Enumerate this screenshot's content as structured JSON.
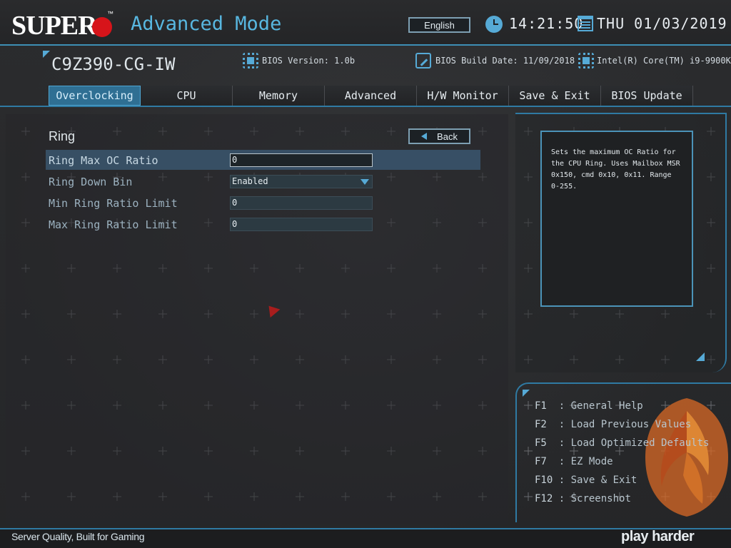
{
  "header": {
    "brand": "SUPER",
    "brand_tm": "™",
    "mode_title": "Advanced Mode",
    "language_button": "English",
    "time": "14:21:50",
    "date": "THU 01/03/2019"
  },
  "board_info": {
    "model": "C9Z390-CG-IW",
    "bios_version": "BIOS Version: 1.0b",
    "bios_build_date": "BIOS Build Date: 11/09/2018",
    "cpu": "Intel(R) Core(TM) i9-9900K"
  },
  "tabs": [
    {
      "label": "Overclocking",
      "active": true
    },
    {
      "label": "CPU",
      "active": false
    },
    {
      "label": "Memory",
      "active": false
    },
    {
      "label": "Advanced",
      "active": false
    },
    {
      "label": "H/W Monitor",
      "active": false
    },
    {
      "label": "Save & Exit",
      "active": false
    },
    {
      "label": "BIOS Update",
      "active": false
    }
  ],
  "page": {
    "heading": "Ring",
    "back_label": "Back",
    "settings": [
      {
        "label": "Ring Max OC Ratio",
        "value": "0",
        "type": "input",
        "selected": true
      },
      {
        "label": "Ring Down Bin",
        "value": "Enabled",
        "type": "dropdown",
        "selected": false
      },
      {
        "label": "Min Ring Ratio Limit",
        "value": "0",
        "type": "input",
        "selected": false
      },
      {
        "label": "Max Ring Ratio Limit",
        "value": "0",
        "type": "input",
        "selected": false
      }
    ]
  },
  "help": {
    "text": "Sets the maximum OC Ratio for the CPU Ring. Uses Mailbox MSR 0x150, cmd 0x10, 0x11. Range 0-255."
  },
  "hotkeys": [
    {
      "key": "F1 ",
      "desc": ": General Help"
    },
    {
      "key": "F2 ",
      "desc": ": Load Previous Values"
    },
    {
      "key": "F5 ",
      "desc": ": Load Optimized Defaults"
    },
    {
      "key": "F7 ",
      "desc": ": EZ Mode"
    },
    {
      "key": "F10",
      "desc": ": Save & Exit"
    },
    {
      "key": "F12",
      "desc": ": Screenshot"
    }
  ],
  "footer": {
    "tagline": "Server Quality, Built for Gaming",
    "slogan": "play harder"
  },
  "colors": {
    "accent": "#56aad6",
    "brand_red": "#d7141a",
    "selected_row": "#3a566e",
    "background": "#2a2b2d"
  },
  "icons": [
    "clock-icon",
    "calendar-icon",
    "chip-icon",
    "build-icon",
    "back-arrow-icon",
    "dropdown-arrow-icon",
    "mouse-cursor-icon"
  ]
}
